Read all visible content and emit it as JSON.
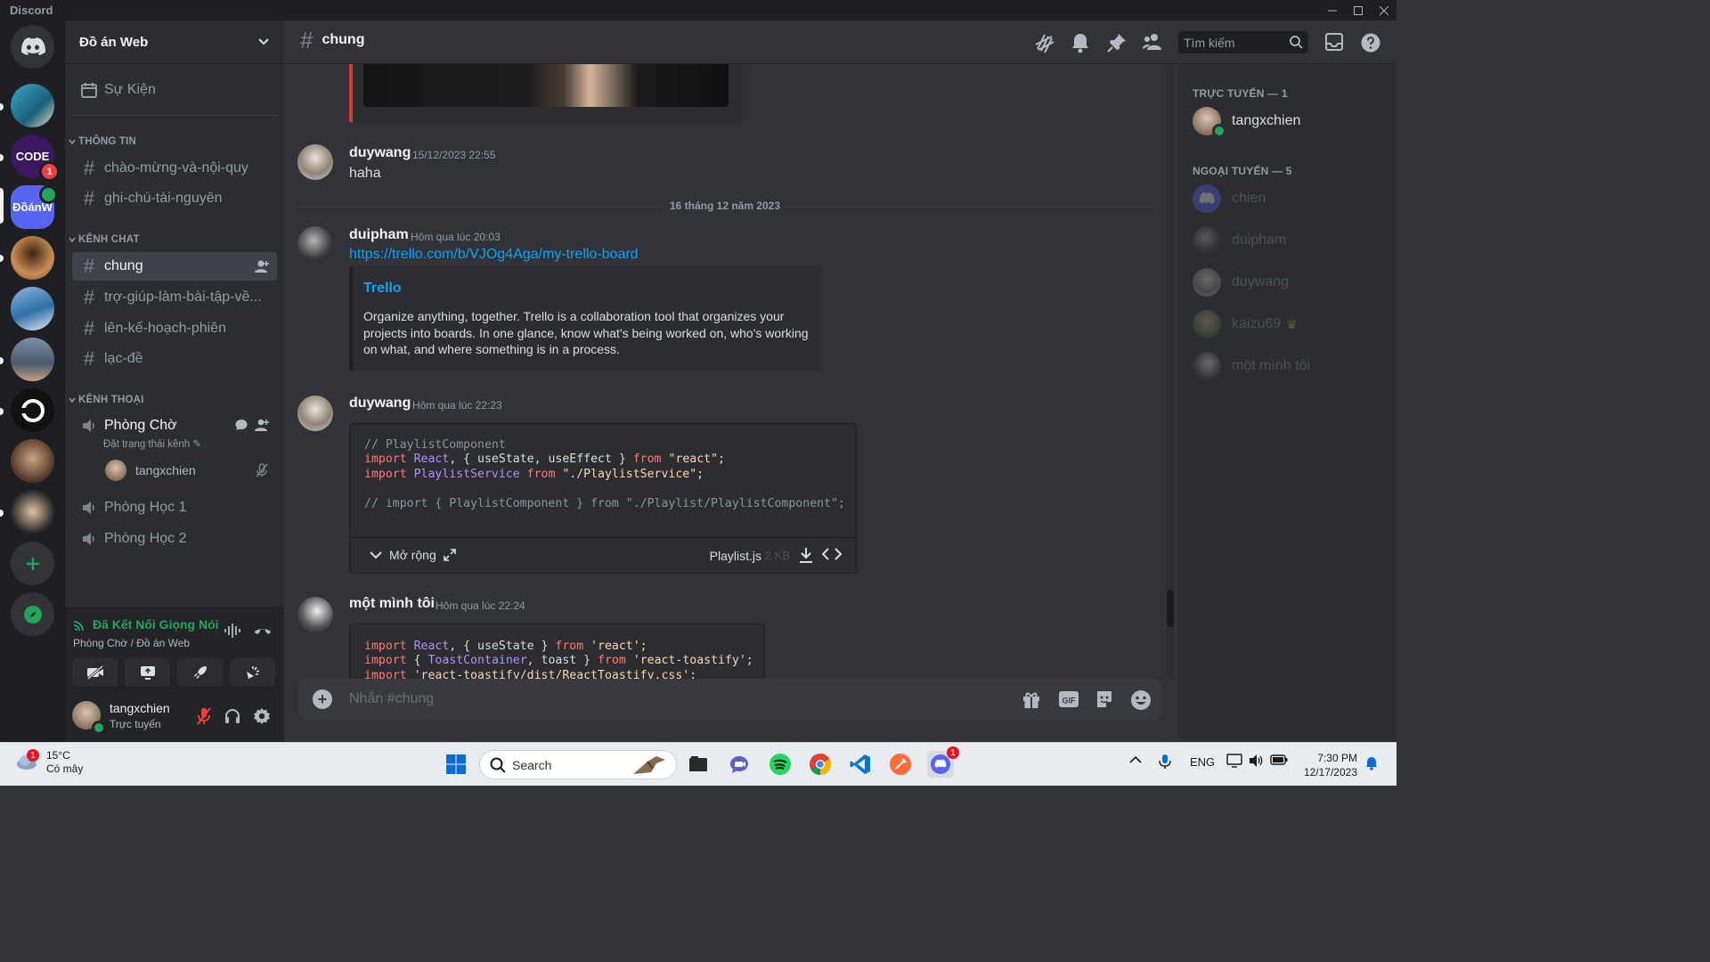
{
  "window": {
    "app_name": "Discord"
  },
  "server": {
    "name": "Đồ án Web",
    "events_label": "Sự Kiện"
  },
  "servers": [
    {
      "name": "CODE",
      "badge": "1"
    },
    {
      "name": "ĐồánW"
    }
  ],
  "categories": {
    "info": "THÔNG TIN",
    "chat": "KÊNH CHAT",
    "voice": "KÊNH THOẠI"
  },
  "text_channels_info": [
    {
      "label": "chào-mừng-và-nội-quy"
    },
    {
      "label": "ghi-chú-tài-nguyên"
    }
  ],
  "text_channels_chat": [
    {
      "label": "chung"
    },
    {
      "label": "trợ-giúp-làm-bài-tập-về..."
    },
    {
      "label": "lên-kế-hoạch-phiên"
    },
    {
      "label": "lạc-đề"
    }
  ],
  "voice_channels": [
    {
      "label": "Phòng Chờ",
      "status": "Đặt trạng thái kênh",
      "user": "tangxchien"
    },
    {
      "label": "Phòng Học 1"
    },
    {
      "label": "Phòng Học 2"
    }
  ],
  "voice_panel": {
    "status": "Đã Kết Nối Giọng Nói",
    "location": "Phòng Chờ / Đồ án Web"
  },
  "user_panel": {
    "name": "tangxchien",
    "status": "Trực tuyến"
  },
  "topbar": {
    "channel": "chung",
    "search_placeholder": "Tìm kiếm"
  },
  "messages": [
    {
      "author": "duywang",
      "time": "15/12/2023 22:55",
      "text": "haha"
    },
    {
      "author": "duipham",
      "time": "Hôm qua lúc 20:03",
      "link": "https://trello.com/b/VJOg4Aga/my-trello-board",
      "embed_title": "Trello",
      "embed_desc": "Organize anything, together. Trello is a collaboration tool that organizes your projects into boards. In one glance, know what's being worked on, who's working on what, and where something is in a process."
    },
    {
      "author": "duywang",
      "time": "Hôm qua lúc 22:23",
      "expand": "Mở rộng",
      "file_name": "Playlist.js",
      "file_size": "2 KB"
    },
    {
      "author": "một mình tôi",
      "time": "Hôm qua lúc 22:24"
    }
  ],
  "date_divider": "16 tháng 12 năm 2023",
  "code1": {
    "l1": "// PlaylistComponent",
    "l2a": "import",
    "l2b": "React",
    "l2c": ", { useState, useEffect } ",
    "l2d": "from",
    "l2e": "\"react\";",
    "l3a": "import",
    "l3b": "PlaylistService",
    "l3c": " from ",
    "l3d": "\"./PlaylistService\";",
    "l4": "// import { PlaylistComponent } from \"./Playlist/PlaylistComponent\";"
  },
  "code2": {
    "l1a": "import",
    "l1b": "React",
    "l1c": ", { useState } ",
    "l1d": "from",
    "l1e": "'react';",
    "l2a": "import",
    "l2b": "{ ",
    "l2c": "ToastContainer",
    "l2d": ", toast } ",
    "l2e": "from",
    "l2f": "'react-toastify';",
    "l3a": "import",
    "l3b": "'react-toastify/dist/ReactToastify.css';"
  },
  "composer": {
    "placeholder": "Nhắn #chung"
  },
  "members": {
    "online_header": "TRỰC TUYẾN — 1",
    "offline_header": "NGOẠI TUYẾN — 5",
    "online": [
      {
        "name": "tangxchien"
      }
    ],
    "offline": [
      {
        "name": "chien"
      },
      {
        "name": "duipham"
      },
      {
        "name": "duywang"
      },
      {
        "name": "kaizu69"
      },
      {
        "name": "một mình tôi"
      }
    ]
  },
  "taskbar": {
    "temp": "15°C",
    "weather": "Có mây",
    "weather_badge": "1",
    "search": "Search",
    "lang": "ENG",
    "time": "7:30 PM",
    "date": "12/17/2023",
    "discord_badge": "1"
  },
  "colors": {
    "accent": "#5865f2",
    "online": "#23a55a",
    "link": "#00a8fc",
    "danger": "#f23f43"
  }
}
